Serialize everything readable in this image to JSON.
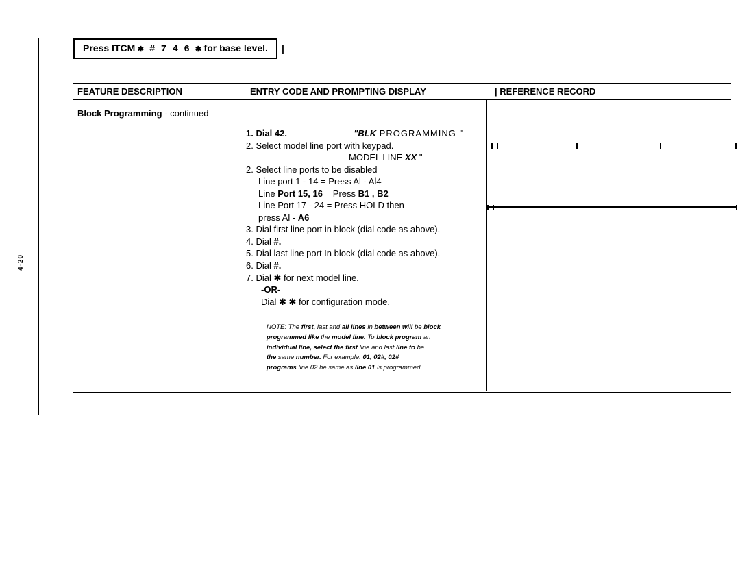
{
  "header": {
    "press": "Press",
    "itcm": "ITCM",
    "keys": "✱ # 7 4 6 ✱",
    "for_base": "for base level.",
    "pipe": "|"
  },
  "columns": {
    "feature": "FEATURE  DESCRIPTION",
    "entry": "ENTRY  CODE  AND  PROMPTING  DISPLAY",
    "reference_pipe": "|",
    "reference": "REFERENCE  RECORD"
  },
  "feature_body": {
    "title": "Block  Programming",
    "sep": " - ",
    "cont": "continued"
  },
  "entry_body": {
    "step1_a": "1. Dial 42.",
    "step1_b": "\"BLK",
    "step1_c": " PROGRAMMING \"",
    "line2": "2. Select  model  line  port  with  keypad.",
    "line3a": "MODEL  LINE  ",
    "line3b": "XX",
    "line3c": "  \"",
    "line4": "2. Select  line  ports  to  be  disabled",
    "line5": "Line  port  1  -  14  =  Press  Al  -  Al4",
    "line6a": "Line ",
    "line6b": "Port 15, 16",
    "line6c": " = Press ",
    "line6d": "B1 , B2",
    "line7": "Line  Port  17  -  24  =  Press  HOLD  then",
    "line8a": "press Al - ",
    "line8b": "A6",
    "line9": "3. Dial  first  line  port  in  block  (dial  code  as  above).",
    "line10a": "4. Dial ",
    "line10b": "#.",
    "line11": "5. Dial  last  line  port  In  block  (dial  code  as  above).",
    "line12a": "6. Dial ",
    "line12b": "#.",
    "line13": "7. Dial  ✱  for  next  model  line.",
    "line14": "-OR-",
    "line15": "Dial  ✱  ✱  for  configuration  mode.",
    "note1a": "NOTE: The ",
    "note1b": "first,",
    "note1c": " last  and ",
    "note1d": "all lines",
    "note1e": " in ",
    "note1f": "between will",
    "note1g": " be ",
    "note1h": "block",
    "note2a": "programmed like ",
    "note2b": "the ",
    "note2c": "model line.",
    "note2d": " To ",
    "note2e": "block program",
    "note2f": " an",
    "note3a": "individual line, select the first ",
    "note3b": "line and last ",
    "note3c": "line to ",
    "note3d": "be",
    "note4a": "the ",
    "note4b": "same ",
    "note4c": "number. ",
    "note4d": "For example: ",
    "note4e": "01, 02#, 02#",
    "note5a": "programs ",
    "note5b": "line 02  he same as ",
    "note5c": "line 01",
    "note5d": " is programmed."
  },
  "side_label": "4-20",
  "ref": {
    "quote": "\" \""
  }
}
